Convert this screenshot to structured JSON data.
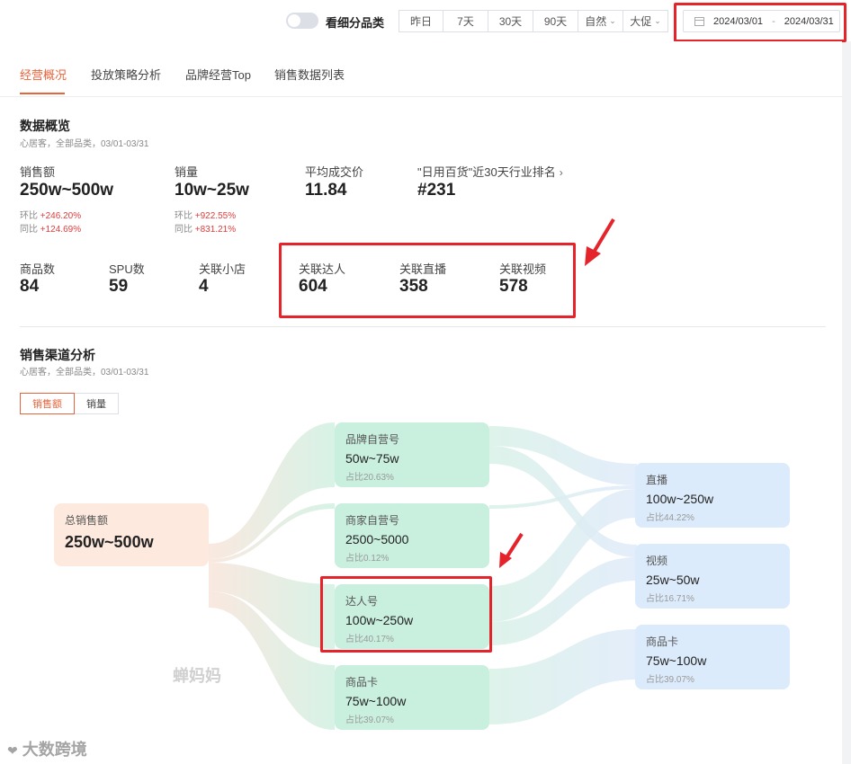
{
  "filter_bar": {
    "toggle_label": "看细分品类",
    "ranges": [
      "昨日",
      "7天",
      "30天",
      "90天"
    ],
    "dropdowns": [
      "自然",
      "大促"
    ],
    "date_start": "2024/03/01",
    "date_sep": "-",
    "date_end": "2024/03/31"
  },
  "tabs": [
    "经营概况",
    "投放策略分析",
    "品牌经营Top",
    "销售数据列表"
  ],
  "overview": {
    "title": "数据概览",
    "subtitle": "心居客，全部品类，03/01-03/31",
    "metrics_row1": [
      {
        "label": "销售额",
        "value": "250w~500w",
        "mom_label": "环比",
        "mom": "+246.20%",
        "yoy_label": "同比",
        "yoy": "+124.69%"
      },
      {
        "label": "销量",
        "value": "10w~25w",
        "mom_label": "环比",
        "mom": "+922.55%",
        "yoy_label": "同比",
        "yoy": "+831.21%"
      },
      {
        "label": "平均成交价",
        "value": "11.84"
      },
      {
        "label": "\"日用百货\"近30天行业排名",
        "value": "#231"
      }
    ],
    "metrics_row2": [
      {
        "label": "商品数",
        "value": "84"
      },
      {
        "label": "SPU数",
        "value": "59"
      },
      {
        "label": "关联小店",
        "value": "4"
      },
      {
        "label": "关联达人",
        "value": "604"
      },
      {
        "label": "关联直播",
        "value": "358"
      },
      {
        "label": "关联视频",
        "value": "578"
      }
    ]
  },
  "channel": {
    "title": "销售渠道分析",
    "subtitle": "心居客，全部品类，03/01-03/31",
    "switch": [
      "销售额",
      "销量"
    ],
    "total": {
      "name": "总销售额",
      "value": "250w~500w"
    },
    "accounts": [
      {
        "name": "品牌自营号",
        "value": "50w~75w",
        "share": "占比20.63%"
      },
      {
        "name": "商家自营号",
        "value": "2500~5000",
        "share": "占比0.12%"
      },
      {
        "name": "达人号",
        "value": "100w~250w",
        "share": "占比40.17%"
      },
      {
        "name": "商品卡",
        "value": "75w~100w",
        "share": "占比39.07%"
      }
    ],
    "carriers": [
      {
        "name": "直播",
        "value": "100w~250w",
        "share": "占比44.22%"
      },
      {
        "name": "视频",
        "value": "25w~50w",
        "share": "占比16.71%"
      },
      {
        "name": "商品卡",
        "value": "75w~100w",
        "share": "占比39.07%"
      }
    ]
  },
  "watermarks": {
    "inner": "蝉妈妈",
    "corner": "大数跨境"
  },
  "colors": {
    "accent": "#e8643c",
    "up": "#e03c3c",
    "highlight": "#e5232b",
    "source_node": "#fde9dd",
    "account_node": "#c9efdf",
    "carrier_node": "#dcebfb"
  }
}
